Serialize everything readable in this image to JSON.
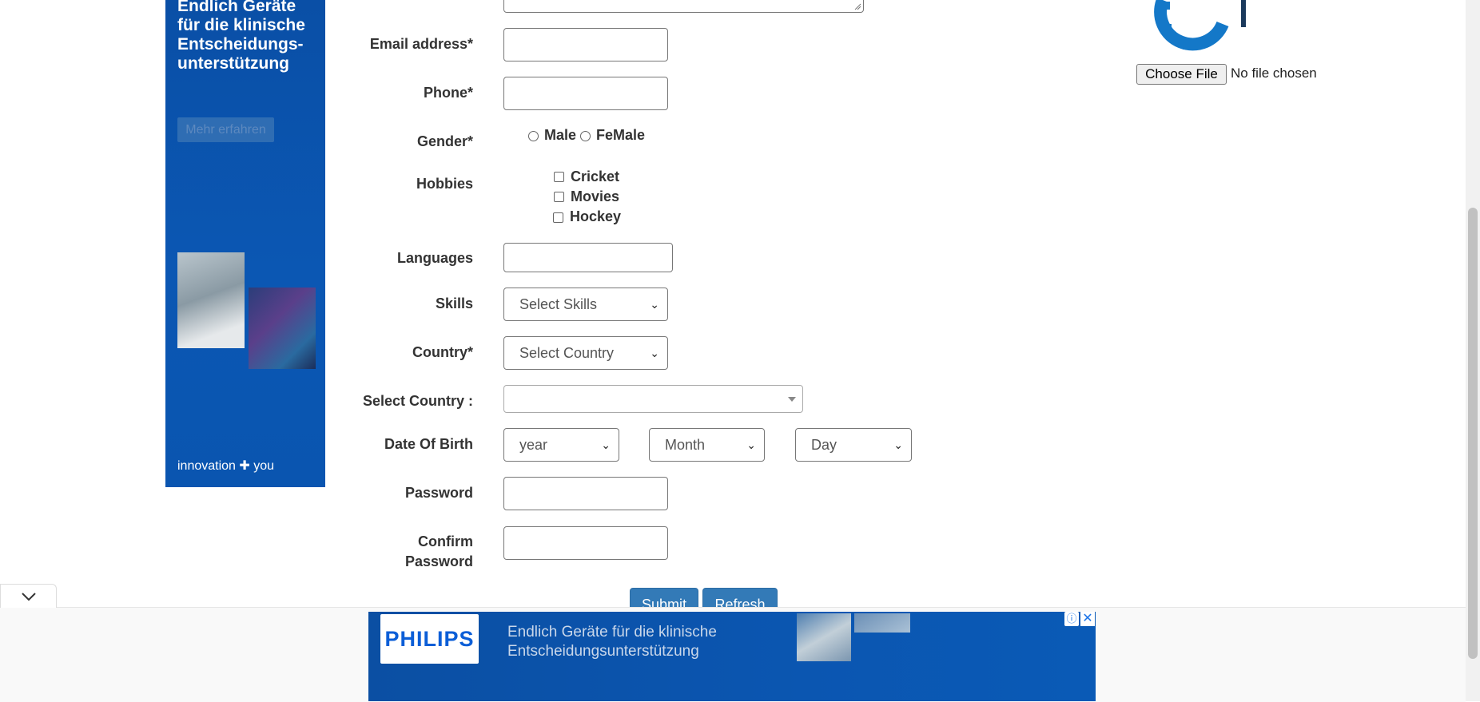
{
  "side_ad": {
    "headline": "Endlich Geräte für die klinische Entscheidungs-unterstützung",
    "cta": "Mehr erfahren",
    "tagline": "innovation ✚ you"
  },
  "form": {
    "email_label": "Email address*",
    "phone_label": "Phone*",
    "gender_label": "Gender*",
    "gender_options": [
      "Male",
      "FeMale"
    ],
    "hobbies_label": "Hobbies",
    "hobbies": [
      "Cricket",
      "Movies",
      "Hockey"
    ],
    "languages_label": "Languages",
    "skills_label": "Skills",
    "skills_selected": "Select Skills",
    "country_label": "Country*",
    "country_selected": "Select Country",
    "select_country_label": "Select Country :",
    "dob_label": "Date Of Birth",
    "dob_year": "year",
    "dob_month": "Month",
    "dob_day": "Day",
    "password_label": "Password",
    "confirm_label": "Confirm Password",
    "submit": "Submit",
    "refresh": "Refresh"
  },
  "file": {
    "button": "Choose File",
    "status": "No file chosen"
  },
  "bottom_ad": {
    "logo": "PHILIPS",
    "text_line1": "Endlich Geräte für die klinische",
    "text_line2": "Entscheidungsunterstützung"
  },
  "colors": {
    "primary_button": "#337ab7",
    "ad_blue": "#0b56b1",
    "gear_blue": "#1478c8"
  }
}
